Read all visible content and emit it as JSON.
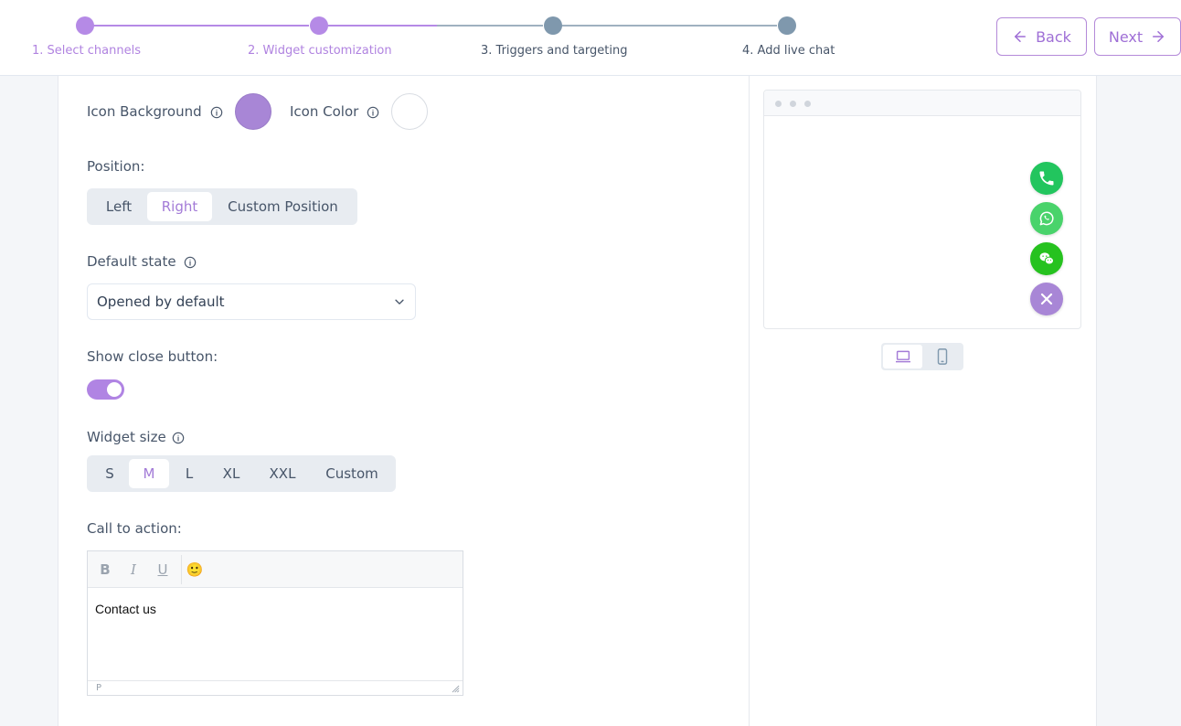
{
  "stepper": {
    "steps": [
      {
        "label": "1. Select channels",
        "state": "done"
      },
      {
        "label": "2. Widget customization",
        "state": "current"
      },
      {
        "label": "3. Triggers and targeting",
        "state": "todo"
      },
      {
        "label": "4. Add live chat",
        "state": "todo"
      }
    ],
    "back_label": "Back",
    "next_label": "Next"
  },
  "form": {
    "icon_background_label": "Icon Background",
    "icon_background_color": "#a886d6",
    "icon_color_label": "Icon Color",
    "icon_color_value": "#ffffff",
    "position_label": "Position:",
    "position_options": [
      "Left",
      "Right",
      "Custom Position"
    ],
    "position_selected": "Right",
    "default_state_label": "Default state",
    "default_state_value": "Opened by default",
    "close_button_label": "Show close button:",
    "close_button_on": true,
    "widget_size_label": "Widget size",
    "widget_size_options": [
      "S",
      "M",
      "L",
      "XL",
      "XXL",
      "Custom"
    ],
    "widget_size_selected": "M",
    "cta_label": "Call to action:",
    "editor": {
      "bold": "B",
      "italic": "I",
      "underline": "U",
      "emoji": "🙂",
      "content": "Contact us",
      "status": "P"
    }
  },
  "preview": {
    "channels": [
      {
        "name": "phone",
        "color": "#22c55e"
      },
      {
        "name": "whatsapp",
        "color": "#49d36b"
      },
      {
        "name": "wechat",
        "color": "#26c21f"
      },
      {
        "name": "close",
        "color": "#a886d6"
      }
    ],
    "device_selected": "desktop"
  },
  "colors": {
    "accent": "#a37bd7",
    "step_done": "#b58ae6",
    "step_todo": "#7f98ad"
  }
}
